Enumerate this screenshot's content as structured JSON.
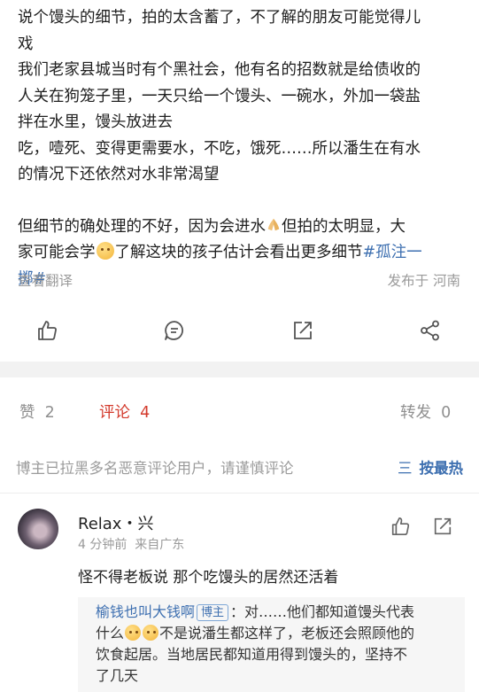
{
  "post": {
    "lines": [
      "说个馒头的细节，拍的太含蓄了，不了解的朋友可能觉得儿",
      "戏",
      "我们老家县城当时有个黑社会，他有名的招数就是给债收的",
      "人关在狗笼子里，一天只给一个馒头、一碗水，外加一袋盐",
      "拌在水里，馒头放进去",
      "吃，噎死、变得更需要水，不吃，饿死……所以潘生在有水",
      "的情况下还依然对水非常渴望"
    ],
    "p2_a": "但细节的确处理的不好，因为会进水",
    "p2_b": "但拍的太明显，大",
    "p2_c": "家可能会学",
    "p2_d": "了解这块的孩子估计会看出更多细节",
    "hashtag_a": "#孤注一",
    "hashtag_b": "掷#",
    "translate": "查看翻译",
    "location": "发布于 河南"
  },
  "actions": [
    "like-icon",
    "comment-icon",
    "share-icon",
    "forward-icon"
  ],
  "tabs": {
    "likes_label": "赞",
    "likes_count": "2",
    "comments_label": "评论",
    "comments_count": "4",
    "reposts_label": "转发",
    "reposts_count": "0"
  },
  "notice": "博主已拉黑多名恶意评论用户，请谨慎评论",
  "sort": {
    "icon": "三",
    "label": "按最热"
  },
  "comment": {
    "name": "Relax・兴",
    "time": "4 分钟前",
    "source": "来自广东",
    "text": "怪不得老板说 那个吃馒头的居然还活着"
  },
  "reply": {
    "name": "榆钱也叫大钱啊",
    "badge": "博主",
    "t1": "：对……他们都知道馒头代表",
    "t2": "什么",
    "t3": "不是说潘生都这样了，老板还会照顾他的",
    "t4": "饮食起居。当地居民都知道用得到馒头的，坚持不",
    "t5": "了几天"
  },
  "colors": {
    "accent": "#d33a2c",
    "link": "#3d6fb0",
    "muted": "#9a9a9a"
  }
}
